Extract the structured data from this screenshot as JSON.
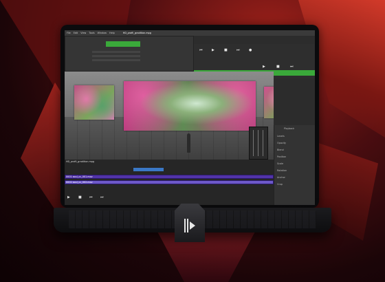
{
  "app": {
    "menu": [
      "File",
      "Edit",
      "View",
      "Tools",
      "Window",
      "Help"
    ],
    "project_tab": "HD_profil_gradition.mpg"
  },
  "timeline": {
    "header": "HD_profil_gradition.mpg",
    "tracks": [
      {
        "label": "0001 soul_cc_001.mov"
      },
      {
        "label": "0002 soul_cc_002.mov"
      }
    ]
  },
  "right_panel": {
    "title": "Playback",
    "items": [
      "Levels",
      "Opacity",
      "Blend",
      "Position",
      "Scale",
      "Rotation",
      "Anchor",
      "Crop"
    ]
  },
  "colors": {
    "accent_green": "#3aa93a",
    "track_purple": "#5234a8",
    "clip_blue": "#3a78c6",
    "brand_red": "#c02b22"
  },
  "icons": [
    "play-icon",
    "stop-icon",
    "rewind-icon",
    "forward-icon",
    "record-icon",
    "brand-logo-icon"
  ]
}
